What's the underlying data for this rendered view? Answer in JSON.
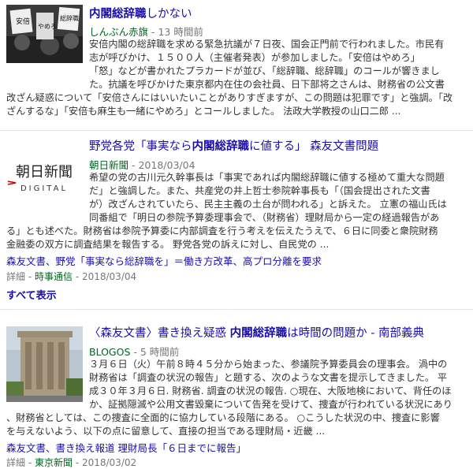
{
  "results": [
    {
      "title_parts": [
        {
          "t": "内閣総辞職",
          "b": true
        },
        {
          "t": "しかない",
          "b": false
        }
      ],
      "source": "しんぶん赤旗",
      "time": "13 時間前",
      "snippet": [
        "安倍内閣の総辞職を求める緊急抗議が７日夜、国会正門前で行われました。市民有",
        "志が呼びかけ、１５００人（主催者発表）が参加しました。「安倍はやめろ」",
        "「怒」などが書かれたプラカードが並び、「総辞職、総辞職」のコールが響きまし",
        "た。抗議を呼びかけた東京都内在住の会社員、日下部将之さんは、財務省の公文書",
        "改ざん疑惑について「安倍さんにはいいたいことがありすぎますが、この問題は犯罪です」と強調。「改",
        "ざんするな」「安倍も麻生も一緒にやめろ」とコールしました。 法政大学教授の山口二郎 ..."
      ]
    },
    {
      "title_parts": [
        {
          "t": "野党各党「事実なら",
          "b": false
        },
        {
          "t": "内閣総辞職",
          "b": true
        },
        {
          "t": "に値する」 森友文書問題",
          "b": false
        }
      ],
      "source": "朝日新聞",
      "time": "2018/03/04",
      "logo_top": "朝日新聞",
      "logo_bottom": "DIGITAL",
      "snippet": [
        "希望の党の古川元久幹事長は「事実であれば内閣総辞職に値する極めて重大な問題",
        "だ」と強調した。また、共産党の井上哲士参院幹事長も「（国会提出された文書",
        "が）改ざんされていたら、民主主義の土台が問われる」と訴えた。 立憲の福山氏は",
        "同番組で「明日の参院予算委理事会で、（財務省）理財局から一定の経過報告があ",
        "る」とも述べた。財務省は参院予算委に内部調査を行う考えを伝えたうえで、６日に同委と衆院財務",
        "金融委の双方に調査結果を報告する。 野党各党の訴えに対し、自民党の ..."
      ],
      "related": "森友文書、野党「事実なら総辞職を」＝働き方改革、高プロ分離を要求",
      "detail_label": "詳細",
      "detail_source": "時事通信",
      "detail_date": "2018/03/04"
    },
    {
      "title_parts": [
        {
          "t": "〈森友文書〉書き換え疑惑 ",
          "b": false
        },
        {
          "t": "内閣総辞職",
          "b": true
        },
        {
          "t": "は時間の問題か - 南部義典",
          "b": false
        }
      ],
      "source": "BLOGOS",
      "time": "5 時間前",
      "snippet": [
        "３月６日（火）午前８時４５分から始まった、参議院予算委員会の理事会。 渦中の",
        "財務省は「調査の状況の報告」と題する、次のような文書を提示してきました。 平",
        "成３０年３月６日. 財務省. 調査の状況の報告. ○現在、大阪地検において、背任のほ",
        "か、証拠隠滅や公用文書毀棄について告発を受けて、捜査が行われている状況にあり",
        "、財務省としては、この捜査に全面的に協力している段階にある。 ○こうした状況の中、捜査に影響",
        "を与えないよう、以下の点に留意して、直接の担当である理財局・近畿 ..."
      ],
      "related": "森友文書、書き換え報道 理財局長「６日までに報告」",
      "detail_label": "詳細",
      "detail_source": "東京新聞",
      "detail_date": "2018/03/02"
    }
  ],
  "show_all": "すべて表示",
  "protest_signs": [
    "安倍",
    "やめろ",
    "総辞職"
  ]
}
